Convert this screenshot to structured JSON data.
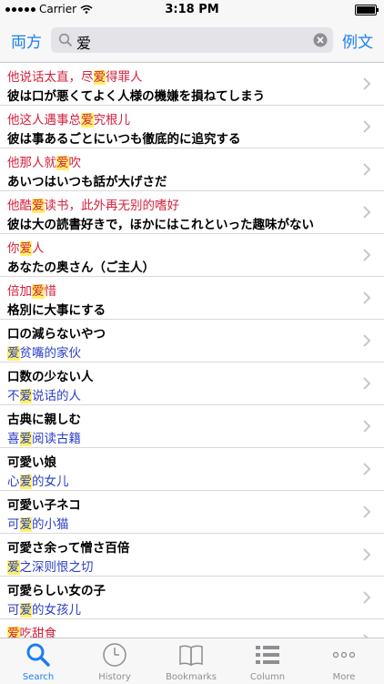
{
  "status_bar": {
    "carrier": "Carrier",
    "time": "3:18 PM"
  },
  "header": {
    "left_button": "両方",
    "search_value": "爱",
    "right_button": "例文"
  },
  "rows": [
    {
      "l1": [
        {
          "t": "他说话太直，尽",
          "c": "red"
        },
        {
          "t": "爱",
          "c": "red",
          "hl": true
        },
        {
          "t": "得罪人",
          "c": "red"
        }
      ],
      "l2": [
        {
          "t": "彼は口が悪くてよく人様の機嫌を損ねてしまう",
          "c": "blk"
        }
      ]
    },
    {
      "l1": [
        {
          "t": "他这人遇事总",
          "c": "red"
        },
        {
          "t": "爱",
          "c": "red",
          "hl": true
        },
        {
          "t": "究根儿",
          "c": "red"
        }
      ],
      "l2": [
        {
          "t": "彼は事あるごとにいつも徹底的に追究する",
          "c": "blk"
        }
      ]
    },
    {
      "l1": [
        {
          "t": "他那人就",
          "c": "red"
        },
        {
          "t": "爱",
          "c": "red",
          "hl": true
        },
        {
          "t": "吹",
          "c": "red"
        }
      ],
      "l2": [
        {
          "t": "あいつはいつも話が大げさだ",
          "c": "blk"
        }
      ]
    },
    {
      "l1": [
        {
          "t": "他酷",
          "c": "red"
        },
        {
          "t": "爱",
          "c": "red",
          "hl": true
        },
        {
          "t": "读书，此外再无别的嗜好",
          "c": "red"
        }
      ],
      "l2": [
        {
          "t": "彼は大の読書好きで，ほかにはこれといった趣味がない",
          "c": "blk"
        }
      ]
    },
    {
      "l1": [
        {
          "t": "你",
          "c": "red"
        },
        {
          "t": "爱",
          "c": "red",
          "hl": true
        },
        {
          "t": "人",
          "c": "red"
        }
      ],
      "l2": [
        {
          "t": "あなたの奥さん（ご主人）",
          "c": "blk"
        }
      ]
    },
    {
      "l1": [
        {
          "t": "倍加",
          "c": "red"
        },
        {
          "t": "爱",
          "c": "red",
          "hl": true
        },
        {
          "t": "惜",
          "c": "red"
        }
      ],
      "l2": [
        {
          "t": "格別に大事にする",
          "c": "blk"
        }
      ]
    },
    {
      "l1": [
        {
          "t": "口の減らないやつ",
          "c": "blk"
        }
      ],
      "l2": [
        {
          "t": "爱",
          "c": "blu",
          "hl": true
        },
        {
          "t": "贫嘴的家伙",
          "c": "blu"
        }
      ]
    },
    {
      "l1": [
        {
          "t": "口数の少ない人",
          "c": "blk"
        }
      ],
      "l2": [
        {
          "t": "不",
          "c": "blu"
        },
        {
          "t": "爱",
          "c": "blu",
          "hl": true
        },
        {
          "t": "说话的人",
          "c": "blu"
        }
      ]
    },
    {
      "l1": [
        {
          "t": "古典に親しむ",
          "c": "blk"
        }
      ],
      "l2": [
        {
          "t": "喜",
          "c": "blu"
        },
        {
          "t": "爱",
          "c": "blu",
          "hl": true
        },
        {
          "t": "阅读古籍",
          "c": "blu"
        }
      ]
    },
    {
      "l1": [
        {
          "t": "可愛い娘",
          "c": "blk"
        }
      ],
      "l2": [
        {
          "t": "心",
          "c": "blu"
        },
        {
          "t": "爱",
          "c": "blu",
          "hl": true
        },
        {
          "t": "的女儿",
          "c": "blu"
        }
      ]
    },
    {
      "l1": [
        {
          "t": "可愛い子ネコ",
          "c": "blk"
        }
      ],
      "l2": [
        {
          "t": "可",
          "c": "blu"
        },
        {
          "t": "爱",
          "c": "blu",
          "hl": true
        },
        {
          "t": "的小猫",
          "c": "blu"
        }
      ]
    },
    {
      "l1": [
        {
          "t": "可愛さ余って憎さ百倍",
          "c": "blk"
        }
      ],
      "l2": [
        {
          "t": "爱",
          "c": "blu",
          "hl": true
        },
        {
          "t": "之深则恨之切",
          "c": "blu"
        }
      ]
    },
    {
      "l1": [
        {
          "t": "可愛らしい女の子",
          "c": "blk"
        }
      ],
      "l2": [
        {
          "t": "可",
          "c": "blu"
        },
        {
          "t": "爱",
          "c": "blu",
          "hl": true
        },
        {
          "t": "的女孩儿",
          "c": "blu"
        }
      ]
    },
    {
      "l1": [
        {
          "t": "爱",
          "c": "red",
          "hl": true
        },
        {
          "t": "吃甜食",
          "c": "red"
        }
      ],
      "l2": []
    }
  ],
  "tabs": [
    {
      "label": "Search",
      "icon": "search-icon",
      "active": true
    },
    {
      "label": "History",
      "icon": "clock-icon",
      "active": false
    },
    {
      "label": "Bookmarks",
      "icon": "book-icon",
      "active": false
    },
    {
      "label": "Column",
      "icon": "list-icon",
      "active": false
    },
    {
      "label": "More",
      "icon": "more-icon",
      "active": false
    }
  ],
  "colors": {
    "accent": "#1a7ff0",
    "red_text": "#d4213c",
    "blue_text": "#2a3ec6",
    "highlight": "#fff06a"
  }
}
